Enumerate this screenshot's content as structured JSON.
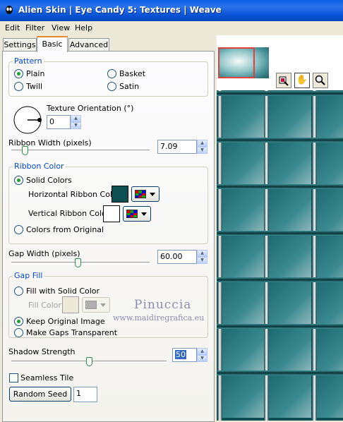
{
  "window": {
    "title": "Alien Skin | Eye Candy 5: Textures | Weave",
    "app_icon": "alien-head-icon"
  },
  "menu": [
    "Edit",
    "Filter",
    "View",
    "Help"
  ],
  "tabs": [
    "Settings",
    "Basic",
    "Advanced"
  ],
  "active_tab": "Basic",
  "pattern": {
    "title": "Pattern",
    "options": [
      "Plain",
      "Basket",
      "Twill",
      "Satin"
    ],
    "selected": "Plain"
  },
  "texture_orientation": {
    "label": "Texture Orientation (°)",
    "value": "0"
  },
  "ribbon_width": {
    "label": "Ribbon Width (pixels)",
    "value": "7.09",
    "slider_fraction": 0.08
  },
  "ribbon_color": {
    "title": "Ribbon Color",
    "solid_label": "Solid Colors",
    "horizontal_label": "Horizontal Ribbon Color",
    "horizontal_color": "#0d4f52",
    "vertical_label": "Vertical Ribbon Color",
    "vertical_color": "#ffffff",
    "from_original_label": "Colors from Original",
    "selected": "Solid Colors"
  },
  "gap_width": {
    "label": "Gap Width (pixels)",
    "value": "60.00",
    "slider_fraction": 0.48
  },
  "gap_fill": {
    "title": "Gap Fill",
    "solid_label": "Fill with Solid Color",
    "fill_color_label": "Fill Color",
    "fill_color": "#ece9d8",
    "keep_label": "Keep Original Image",
    "transparent_label": "Make Gaps Transparent",
    "selected": "Keep Original Image"
  },
  "shadow_strength": {
    "label": "Shadow Strength",
    "value": "50",
    "slider_fraction": 0.5
  },
  "seamless": {
    "label": "Seamless Tile",
    "checked": false
  },
  "random_seed": {
    "button_label": "Random Seed",
    "value": "1"
  },
  "preview": {
    "tools": [
      "eye-dropper-icon",
      "hand-icon",
      "zoom-icon"
    ],
    "active_tool": "hand-icon"
  },
  "watermark": {
    "line1": "Pinuccia",
    "line2": "www.maidiregrafica.eu"
  },
  "colors": {
    "accent": "#0046d5",
    "title_bar": "#0a5ee3",
    "weave_dark": "#0c4f55"
  }
}
